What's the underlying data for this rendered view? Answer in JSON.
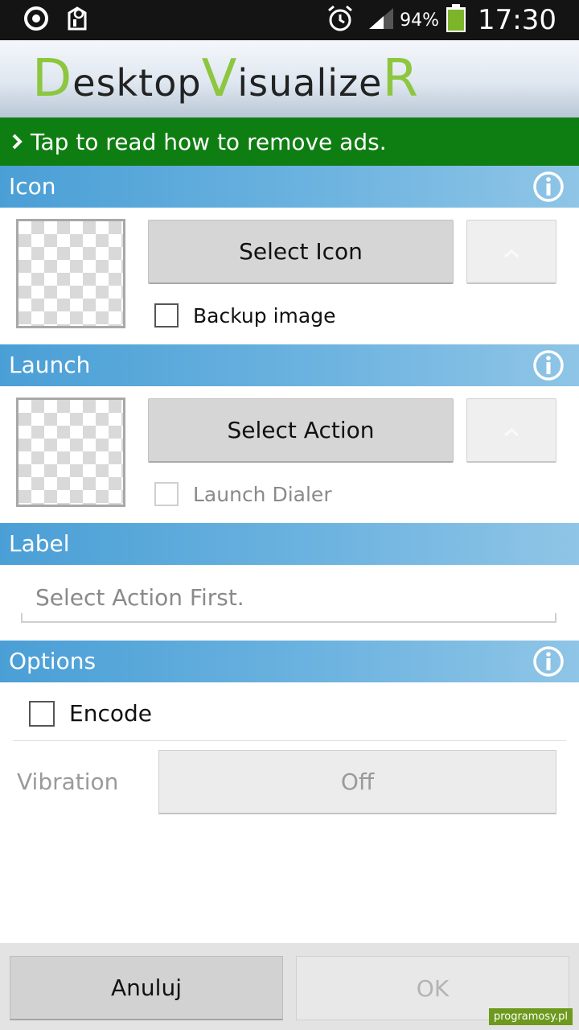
{
  "status_bar": {
    "battery_percent": "94%",
    "time": "17:30",
    "icons": [
      "sync-icon",
      "notification-icon",
      "alarm-icon",
      "signal-icon",
      "battery-icon"
    ]
  },
  "app": {
    "logo_text": "DesktopVisualizeR",
    "logo_parts": [
      "D",
      "esktop",
      "V",
      "isualize",
      "R"
    ],
    "accent_color": "#8dc63f"
  },
  "ad_banner": {
    "text": "Tap to read how to remove ads.",
    "color": "#0f7e12"
  },
  "sections": {
    "icon": {
      "title": "Icon",
      "button": "Select Icon",
      "checkbox_label": "Backup image",
      "checkbox_checked": false
    },
    "launch": {
      "title": "Launch",
      "button": "Select Action",
      "checkbox_label": "Launch Dialer",
      "checkbox_checked": false,
      "checkbox_enabled": false
    },
    "label": {
      "title": "Label",
      "placeholder": "Select Action First."
    },
    "options": {
      "title": "Options",
      "encode_label": "Encode",
      "encode_checked": false,
      "vibration_label": "Vibration",
      "vibration_value": "Off"
    }
  },
  "footer": {
    "cancel": "Anuluj",
    "ok": "OK"
  },
  "watermark": "programosy.pl"
}
